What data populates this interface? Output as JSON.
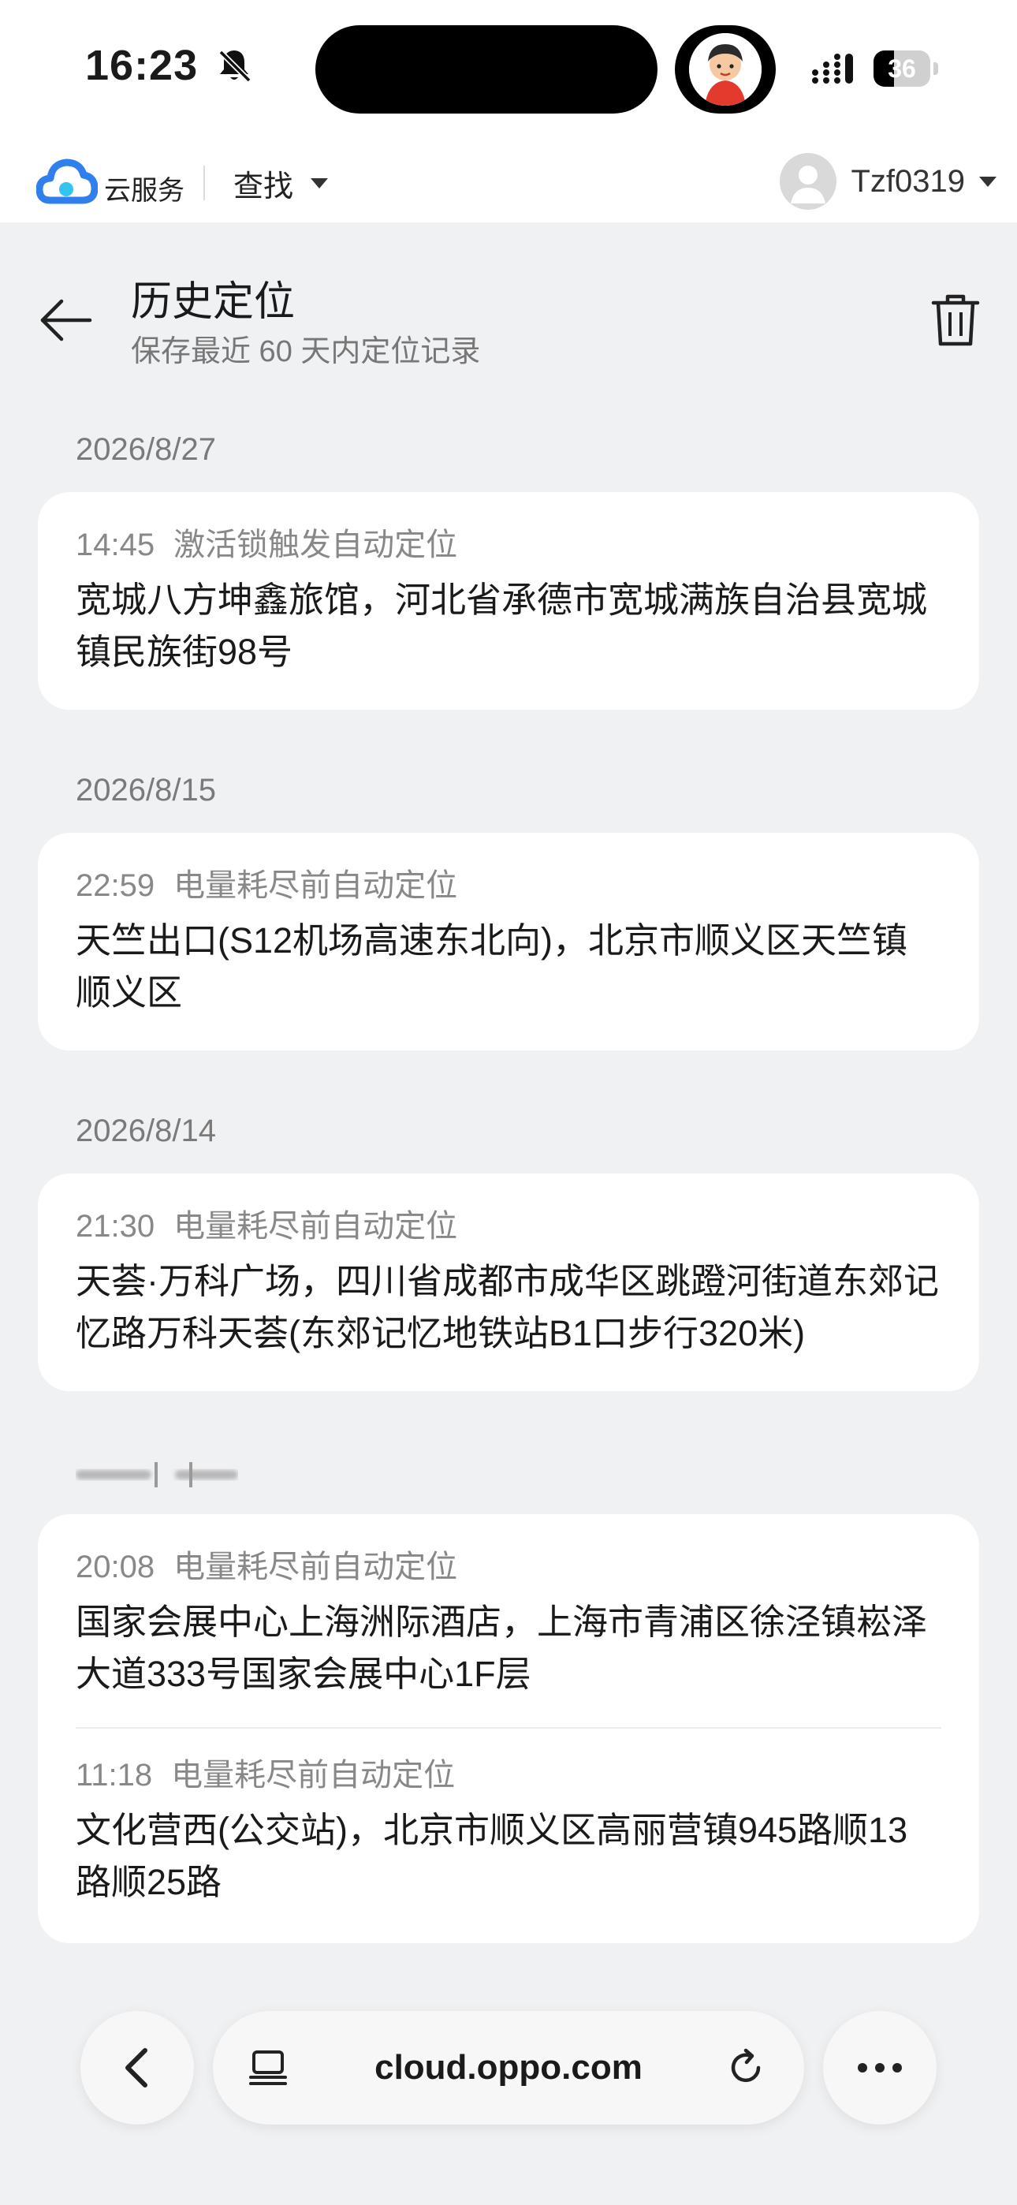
{
  "status_bar": {
    "time": "16:23",
    "battery_level": "36",
    "battery_fraction": 0.36,
    "icons": [
      "bell-slash-icon",
      "signal-icon",
      "battery-icon"
    ]
  },
  "site_header": {
    "brand": "云服务",
    "menu_label": "查找",
    "username": "Tzf0319",
    "accent_color": "#2f80ed"
  },
  "page": {
    "title": "历史定位",
    "subtitle": "保存最近 60 天内定位记录"
  },
  "groups": [
    {
      "date": "2026/8/27",
      "entries": [
        {
          "time": "14:45",
          "trigger": "激活锁触发自动定位",
          "address": "宽城八方坤鑫旅馆，河北省承德市宽城满族自治县宽城镇民族街98号"
        }
      ]
    },
    {
      "date": "2026/8/15",
      "entries": [
        {
          "time": "22:59",
          "trigger": "电量耗尽前自动定位",
          "address": "天竺出口(S12机场高速东北向)，北京市顺义区天竺镇顺义区"
        }
      ]
    },
    {
      "date": "2026/8/14",
      "entries": [
        {
          "time": "21:30",
          "trigger": "电量耗尽前自动定位",
          "address": "天荟·万科广场，四川省成都市成华区跳蹬河街道东郊记忆路万科天荟(东郊记忆地铁站B1口步行320米)"
        }
      ]
    },
    {
      "date": "",
      "entries": [
        {
          "time": "20:08",
          "trigger": "电量耗尽前自动定位",
          "address": "国家会展中心上海洲际酒店，上海市青浦区徐泾镇崧泽大道333号国家会展中心1F层"
        },
        {
          "time": "11:18",
          "trigger": "电量耗尽前自动定位",
          "address": "文化营西(公交站)，北京市顺义区高丽营镇945路顺13路顺25路"
        }
      ]
    }
  ],
  "browser": {
    "url": "cloud.oppo.com"
  }
}
